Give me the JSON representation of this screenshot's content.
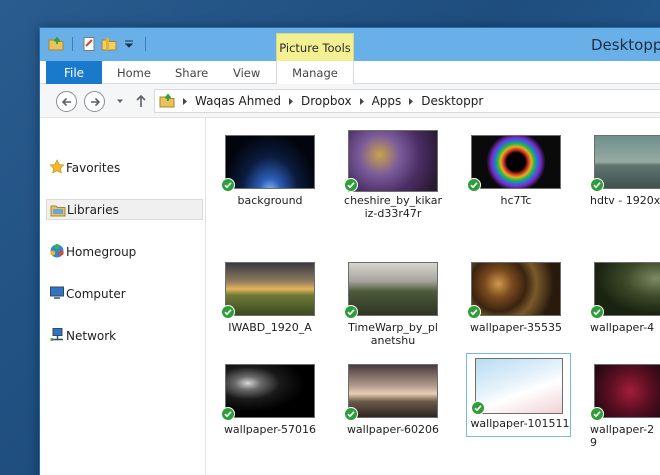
{
  "window": {
    "title": "Desktoppr"
  },
  "quick_access": {
    "icons": [
      "folder-icon",
      "properties-icon",
      "new-folder-icon",
      "dropdown-icon"
    ]
  },
  "ribbon": {
    "context_group": "Picture Tools",
    "tabs": [
      "File",
      "Home",
      "Share",
      "View",
      "Manage"
    ]
  },
  "address": {
    "crumbs": [
      "Waqas Ahmed",
      "Dropbox",
      "Apps",
      "Desktoppr"
    ]
  },
  "nav_pane": {
    "items": [
      {
        "label": "Favorites",
        "icon": "star-icon"
      },
      {
        "label": "Libraries",
        "icon": "libraries-icon",
        "selected": true
      },
      {
        "label": "Homegroup",
        "icon": "homegroup-icon"
      },
      {
        "label": "Computer",
        "icon": "computer-icon"
      },
      {
        "label": "Network",
        "icon": "network-icon"
      }
    ]
  },
  "files": [
    {
      "name": "background",
      "thumb": "space-planet"
    },
    {
      "name": "cheshire_by_kikar\niz-d33r47r",
      "thumb": "cheshire-cat"
    },
    {
      "name": "hc7Tc",
      "thumb": "neon-rings"
    },
    {
      "name": "hdtv - 1920x",
      "thumb": "sea-sky"
    },
    {
      "name": "IWABD_1920_A",
      "thumb": "sunset-car"
    },
    {
      "name": "TimeWarp_by_pl\nanetshu",
      "thumb": "road-landscape"
    },
    {
      "name": "wallpaper-35535",
      "thumb": "fractal-brown"
    },
    {
      "name": "wallpaper-4",
      "thumb": "dark-trees"
    },
    {
      "name": "wallpaper-57016",
      "thumb": "dark-face"
    },
    {
      "name": "wallpaper-60206",
      "thumb": "mountain-dusk"
    },
    {
      "name": "wallpaper-101511",
      "thumb": "cartoon-drawing",
      "selected": true
    },
    {
      "name": "wallpaper-2\n9",
      "thumb": "red-tentacles"
    }
  ],
  "colors": {
    "title_bar": "#6ab0e8",
    "file_tab": "#1979ca",
    "context_tab": "#f2f093",
    "sync_check": "#2f9d3b"
  }
}
